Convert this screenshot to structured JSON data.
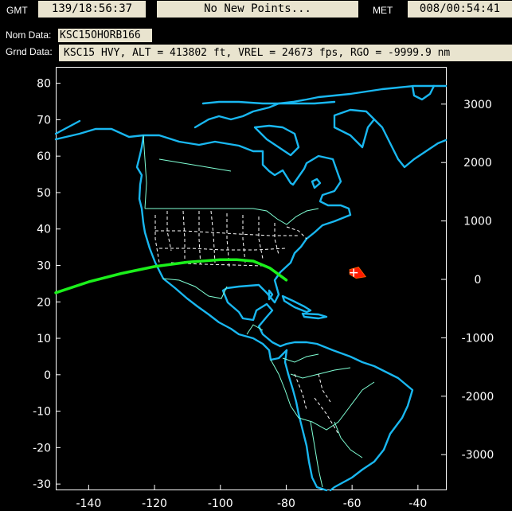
{
  "header": {
    "gmt_label": "GMT",
    "gmt_value": "139/18:56:37",
    "status": "No New Points...",
    "met_label": "MET",
    "met_value": "008/00:54:41"
  },
  "nom_data": {
    "label": "Nom Data:",
    "value": "KSC15OHORB166"
  },
  "grnd_data": {
    "label": "Grnd Data:",
    "value": "KSC15 HVY, ALT = 413802 ft, VREL = 24673 fps, RGO = -9999.9 nm"
  },
  "map": {
    "lon_ticks": [
      "-140",
      "-120",
      "-100",
      "-80",
      "-60",
      "-40"
    ],
    "lat_ticks": [
      "80",
      "70",
      "60",
      "50",
      "40",
      "30",
      "20",
      "10",
      "0",
      "-10",
      "-20",
      "-30"
    ],
    "range_ticks": [
      "3000",
      "2000",
      "1000",
      "0",
      "-1000",
      "-2000",
      "-3000"
    ],
    "colors": {
      "coast": "#19b7f0",
      "borders": "#7fffd4",
      "states": "#ffffff",
      "track": "#1bf01b",
      "marker": "#ff1a00"
    },
    "track_points": [
      [
        -150,
        22.5
      ],
      [
        -140,
        25.5
      ],
      [
        -130,
        27.8
      ],
      [
        -120,
        29.7
      ],
      [
        -110,
        30.9
      ],
      [
        -100,
        31.6
      ],
      [
        -95,
        31.6
      ],
      [
        -90,
        31.2
      ],
      [
        -85,
        29.3
      ],
      [
        -80,
        26.0
      ]
    ],
    "marker": {
      "lon": -59.5,
      "lat": 28.0
    }
  }
}
